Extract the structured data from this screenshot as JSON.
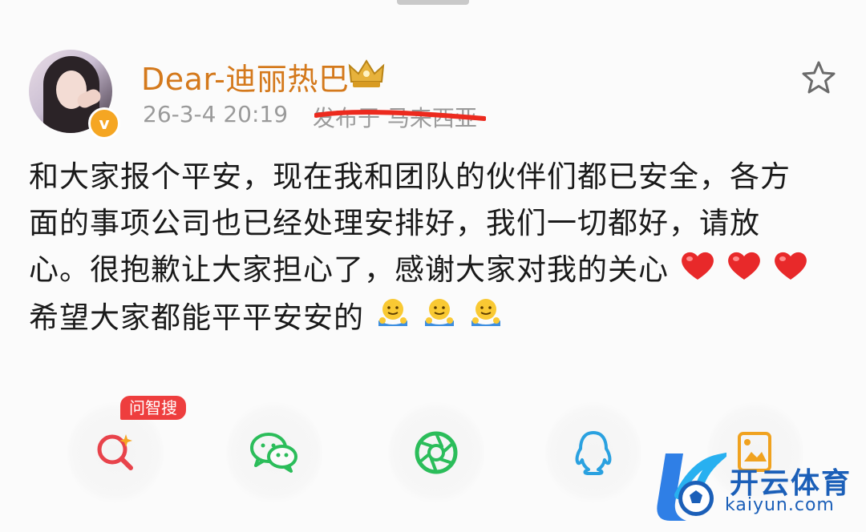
{
  "post": {
    "author": "Dear-迪丽热巴",
    "time": "26-3-4 20:19",
    "location": "发布于 马来西亚",
    "content_lines": [
      "和大家报个平安，现在我和团队的伙伴们都已安全，各方",
      "面的事项公司也已经处理安排好，我们一切都好，请放",
      "心。很抱歉让大家担心了，感谢大家对我的关心",
      "希望大家都能平平安安的"
    ]
  },
  "share_bar": {
    "ai_search_badge": "问智搜",
    "buttons": [
      "ai-search",
      "wechat",
      "moments",
      "qq",
      "save-image"
    ]
  },
  "watermark": {
    "title": "开云体育",
    "url": "kaiyun.com"
  },
  "colors": {
    "username": "#d4791c",
    "verified": "#f5a623",
    "heart": "#e8292a",
    "badge": "#ee3e3e",
    "wechat": "#2bbd5a",
    "qq": "#2aa1e0"
  }
}
